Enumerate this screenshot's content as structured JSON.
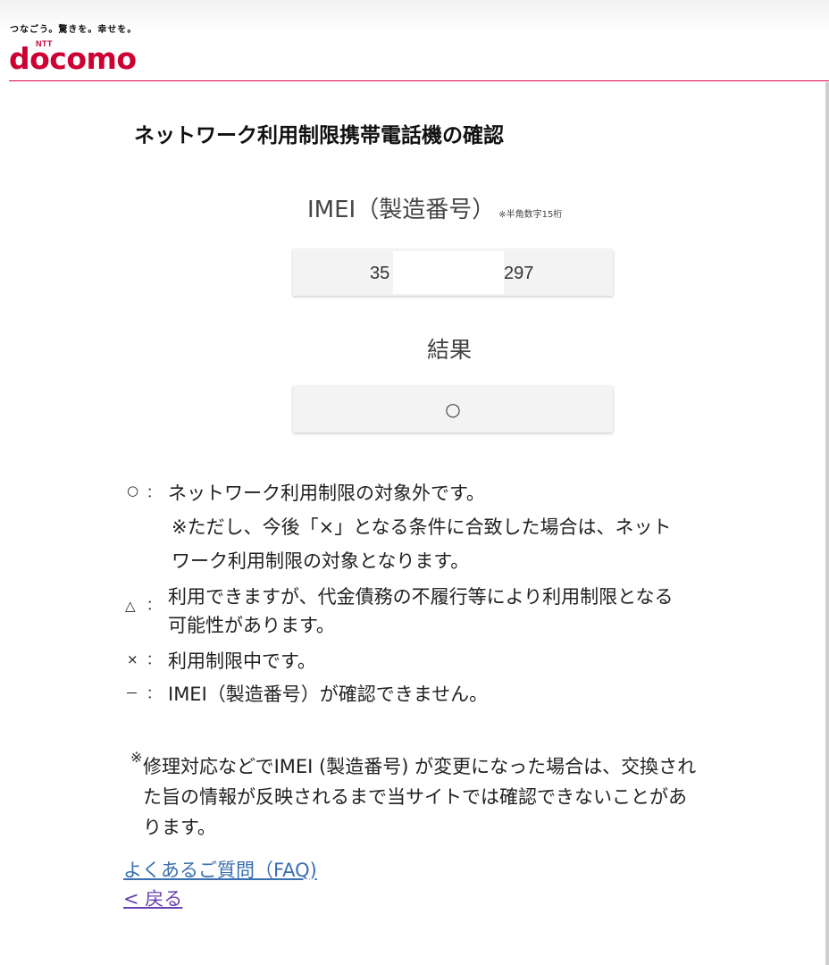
{
  "header": {
    "slogan": "つなごう。驚きを。幸せを。",
    "logo_ntt": "NTT",
    "logo_text": "docomo",
    "brand_color": "#cc0033"
  },
  "page": {
    "title": "ネットワーク利用制限携帯電話機の確認"
  },
  "imei": {
    "label": "IMEI（製造番号）",
    "note": "※半角数字15桁",
    "value_prefix": "35",
    "value_suffix": "297"
  },
  "result": {
    "label": "結果",
    "value": "○"
  },
  "legend": [
    {
      "symbol": "○",
      "lines": [
        "ネットワーク利用制限の対象外です。",
        "※ただし、今後「×」となる条件に合致した場合は、ネット",
        "ワーク利用制限の対象となります。"
      ]
    },
    {
      "symbol": "△",
      "lines": [
        "利用できますが、代金債務の不履行等により利用制限となる",
        "可能性があります。"
      ]
    },
    {
      "symbol": "×",
      "lines": [
        "利用制限中です。"
      ]
    },
    {
      "symbol": "－",
      "lines": [
        "IMEI（製造番号）が確認できません。"
      ]
    }
  ],
  "legend_colon": "：",
  "note": {
    "mark": "※",
    "lines": [
      "修理対応などでIMEI (製造番号) が変更になった場合は、交換され",
      "た旨の情報が反映されるまで当サイトでは確認できないことがあ",
      "ります。"
    ]
  },
  "links": {
    "faq": "よくあるご質問（FAQ)",
    "back": "< 戻る"
  }
}
